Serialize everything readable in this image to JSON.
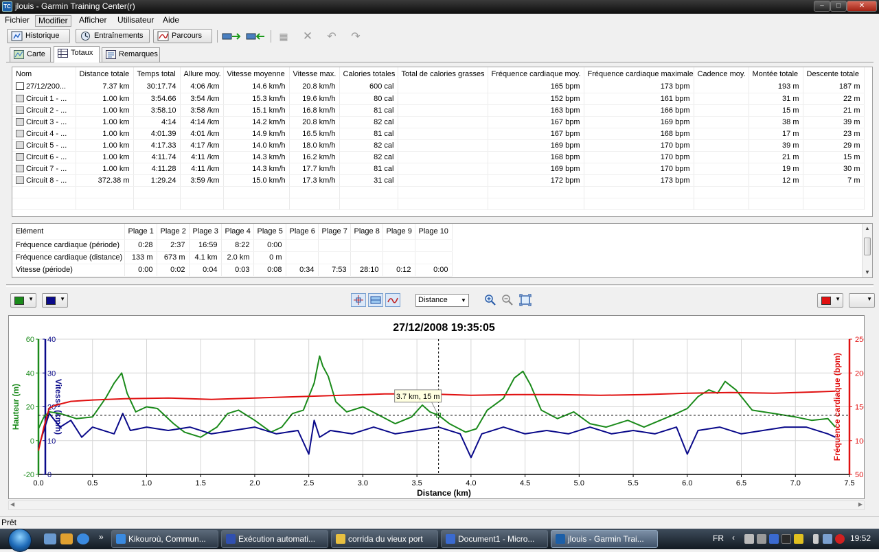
{
  "window": {
    "title": "jlouis - Garmin Training Center(r)",
    "app_icon": "TC"
  },
  "menu": [
    "Fichier",
    "Modifier",
    "Afficher",
    "Utilisateur",
    "Aide"
  ],
  "toolbar": {
    "historique": "Historique",
    "entrainements": "Entraînements",
    "parcours": "Parcours"
  },
  "tabs": [
    "Carte",
    "Totaux",
    "Remarques"
  ],
  "totals": {
    "columns": [
      "Nom",
      "Distance totale",
      "Temps total",
      "Allure moy.",
      "Vitesse moyenne",
      "Vitesse max.",
      "Calories totales",
      "Total de calories grasses",
      "Fréquence cardiaque moy.",
      "Fréquence cardiaque maximale",
      "Cadence moy.",
      "Montée totale",
      "Descente totale"
    ],
    "rows": [
      [
        "27/12/200...",
        "7.37 km",
        "30:17.74",
        "4:06 /km",
        "14.6 km/h",
        "20.8 km/h",
        "600 cal",
        "",
        "165 bpm",
        "173 bpm",
        "",
        "193 m",
        "187 m"
      ],
      [
        "Circuit 1 - ...",
        "1.00 km",
        "3:54.66",
        "3:54 /km",
        "15.3 km/h",
        "19.6 km/h",
        "80 cal",
        "",
        "152 bpm",
        "161 bpm",
        "",
        "31 m",
        "22 m"
      ],
      [
        "Circuit 2 - ...",
        "1.00 km",
        "3:58.10",
        "3:58 /km",
        "15.1 km/h",
        "16.8 km/h",
        "81 cal",
        "",
        "163 bpm",
        "166 bpm",
        "",
        "15 m",
        "21 m"
      ],
      [
        "Circuit 3 - ...",
        "1.00 km",
        "4:14",
        "4:14 /km",
        "14.2 km/h",
        "20.8 km/h",
        "82 cal",
        "",
        "167 bpm",
        "169 bpm",
        "",
        "38 m",
        "39 m"
      ],
      [
        "Circuit 4 - ...",
        "1.00 km",
        "4:01.39",
        "4:01 /km",
        "14.9 km/h",
        "16.5 km/h",
        "81 cal",
        "",
        "167 bpm",
        "168 bpm",
        "",
        "17 m",
        "23 m"
      ],
      [
        "Circuit 5 - ...",
        "1.00 km",
        "4:17.33",
        "4:17 /km",
        "14.0 km/h",
        "18.0 km/h",
        "82 cal",
        "",
        "169 bpm",
        "170 bpm",
        "",
        "39 m",
        "29 m"
      ],
      [
        "Circuit 6 - ...",
        "1.00 km",
        "4:11.74",
        "4:11 /km",
        "14.3 km/h",
        "16.2 km/h",
        "82 cal",
        "",
        "168 bpm",
        "170 bpm",
        "",
        "21 m",
        "15 m"
      ],
      [
        "Circuit 7 - ...",
        "1.00 km",
        "4:11.28",
        "4:11 /km",
        "14.3 km/h",
        "17.7 km/h",
        "81 cal",
        "",
        "169 bpm",
        "170 bpm",
        "",
        "19 m",
        "30 m"
      ],
      [
        "Circuit 8 - ...",
        "372.38 m",
        "1:29.24",
        "3:59 /km",
        "15.0 km/h",
        "17.3 km/h",
        "31 cal",
        "",
        "172 bpm",
        "173 bpm",
        "",
        "12 m",
        "7 m"
      ]
    ]
  },
  "zones": {
    "columns": [
      "Elément",
      "Plage 1",
      "Plage 2",
      "Plage 3",
      "Plage 4",
      "Plage 5",
      "Plage 6",
      "Plage 7",
      "Plage 8",
      "Plage 9",
      "Plage 10"
    ],
    "rows": [
      [
        "Fréquence cardiaque (période)",
        "0:28",
        "2:37",
        "16:59",
        "8:22",
        "0:00",
        "",
        "",
        "",
        "",
        ""
      ],
      [
        "Fréquence cardiaque (distance)",
        "133 m",
        "673 m",
        "4.1 km",
        "2.0 km",
        "0 m",
        "",
        "",
        "",
        "",
        ""
      ],
      [
        "Vitesse (période)",
        "0:00",
        "0:02",
        "0:04",
        "0:03",
        "0:08",
        "0:34",
        "7:53",
        "28:10",
        "0:12",
        "0:00"
      ]
    ]
  },
  "chart_controls": {
    "left_color_1": "#1a8a1a",
    "left_color_2": "#0a0a8a",
    "right_color": "#e01010",
    "x_axis_select": "Distance"
  },
  "chart_data": {
    "type": "line",
    "title": "27/12/2008 19:35:05",
    "xlabel": "Distance (km)",
    "x_range": [
      0,
      7.5
    ],
    "x_ticks": [
      "0.0",
      "0.5",
      "1.0",
      "1.5",
      "2.0",
      "2.5",
      "3.0",
      "3.5",
      "4.0",
      "4.5",
      "5.0",
      "5.5",
      "6.0",
      "6.5",
      "7.0",
      "7.5"
    ],
    "grid": true,
    "y_axes": [
      {
        "label": "Hauteur (m)",
        "range": [
          -20,
          60
        ],
        "ticks": [
          "60",
          "40",
          "20",
          "0",
          "-20"
        ],
        "color": "#1a8a1a"
      },
      {
        "label": "Vitesse (km/h)",
        "range": [
          0,
          40
        ],
        "ticks": [
          "40",
          "30",
          "20",
          "10",
          "0"
        ],
        "color": "#0a0a8a"
      },
      {
        "label": "Fréquence cardiaque (bpm)",
        "range": [
          50,
          250
        ],
        "ticks": [
          "250",
          "200",
          "150",
          "100",
          "50"
        ],
        "color": "#e01010"
      }
    ],
    "series": [
      {
        "axis": 0,
        "x": [
          0.0,
          0.05,
          0.1,
          0.2,
          0.35,
          0.5,
          0.62,
          0.7,
          0.77,
          0.82,
          0.9,
          1.0,
          1.1,
          1.25,
          1.35,
          1.5,
          1.65,
          1.75,
          1.85,
          2.0,
          2.15,
          2.25,
          2.35,
          2.45,
          2.55,
          2.6,
          2.63,
          2.68,
          2.75,
          2.85,
          3.0,
          3.15,
          3.3,
          3.45,
          3.55,
          3.62,
          3.7,
          3.8,
          3.95,
          4.05,
          4.15,
          4.3,
          4.4,
          4.48,
          4.55,
          4.65,
          4.8,
          4.95,
          5.1,
          5.25,
          5.45,
          5.6,
          5.75,
          5.9,
          6.0,
          6.1,
          6.2,
          6.28,
          6.35,
          6.45,
          6.6,
          6.8,
          7.0,
          7.15,
          7.3,
          7.37
        ],
        "y": [
          7,
          14,
          17,
          16,
          13,
          14,
          25,
          34,
          40,
          28,
          17,
          20,
          19,
          10,
          5,
          2,
          8,
          16,
          18,
          12,
          5,
          8,
          16,
          18,
          34,
          50,
          44,
          38,
          23,
          17,
          20,
          15,
          10,
          14,
          21,
          17,
          15,
          10,
          5,
          7,
          18,
          25,
          37,
          41,
          33,
          18,
          13,
          17,
          10,
          8,
          12,
          8,
          12,
          16,
          19,
          26,
          30,
          28,
          35,
          30,
          18,
          16,
          14,
          12,
          13,
          8
        ]
      },
      {
        "axis": 1,
        "x": [
          0.0,
          0.1,
          0.2,
          0.3,
          0.4,
          0.5,
          0.7,
          0.78,
          0.85,
          1.0,
          1.2,
          1.4,
          1.6,
          1.8,
          2.0,
          2.2,
          2.4,
          2.5,
          2.55,
          2.6,
          2.7,
          2.9,
          3.1,
          3.3,
          3.5,
          3.7,
          3.9,
          4.0,
          4.1,
          4.3,
          4.5,
          4.7,
          4.9,
          5.1,
          5.3,
          5.5,
          5.7,
          5.9,
          6.0,
          6.1,
          6.3,
          6.5,
          6.7,
          6.9,
          7.1,
          7.3,
          7.37
        ],
        "y": [
          8,
          18,
          14,
          16,
          11,
          14,
          12,
          18,
          13,
          14,
          13,
          14,
          12,
          13,
          14,
          12,
          13,
          6,
          16,
          11,
          13,
          12,
          14,
          12,
          13,
          14,
          12,
          5,
          12,
          14,
          12,
          13,
          12,
          14,
          12,
          13,
          12,
          14,
          6,
          13,
          14,
          12,
          13,
          14,
          14,
          12,
          11
        ]
      },
      {
        "axis": 2,
        "x": [
          0.0,
          0.05,
          0.1,
          0.15,
          0.3,
          0.5,
          0.8,
          1.2,
          1.6,
          2.0,
          2.4,
          2.8,
          3.2,
          3.6,
          4.0,
          4.4,
          4.8,
          5.2,
          5.6,
          6.0,
          6.4,
          6.8,
          7.2,
          7.37
        ],
        "y": [
          85,
          120,
          148,
          152,
          158,
          160,
          162,
          163,
          161,
          163,
          165,
          167,
          169,
          169,
          167,
          168,
          168,
          167,
          168,
          170,
          171,
          170,
          172,
          173
        ]
      }
    ],
    "crosshair": {
      "x": 3.7,
      "y": 15
    },
    "tooltip": "3.7 km, 15 m"
  },
  "status": "Prêt",
  "taskbar": {
    "buttons": [
      "Kikouroù, Commun...",
      "Exécution automati...",
      "corrida du vieux port",
      "Document1 - Micro...",
      "jlouis - Garmin Trai..."
    ],
    "lang": "FR",
    "clock": "19:52"
  }
}
